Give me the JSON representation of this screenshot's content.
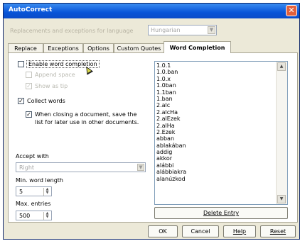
{
  "window": {
    "title": "AutoCorrect"
  },
  "replacements": {
    "label": "Replacements and exceptions for language",
    "language": "Hungarian"
  },
  "tabs": [
    {
      "label": "Replace"
    },
    {
      "label": "Exceptions"
    },
    {
      "label": "Options"
    },
    {
      "label": "Custom Quotes"
    },
    {
      "label": "Word Completion"
    }
  ],
  "word_completion": {
    "enable_label": "Enable word completion",
    "enable_checked": false,
    "append_space_label": "Append space",
    "show_tip_label": "Show as tip",
    "collect_words_label": "Collect words",
    "collect_words_checked": true,
    "when_closing_label_1": "When closing a document, save the",
    "when_closing_label_2": "list for later use in other documents.",
    "when_closing_checked": true,
    "accept_with_label": "Accept with",
    "accept_with_value": "Right",
    "min_length_label": "Min. word length",
    "min_length_value": "5",
    "max_entries_label": "Max. entries",
    "max_entries_value": "500",
    "words": [
      "1.0.1",
      "1.0.ban",
      "1.0.x",
      "1.0ban",
      "1.1ban",
      "1.ban",
      "2.alc",
      "2.alcHa",
      "2.alEzek",
      "2.alHa",
      "2.Ezek",
      "abban",
      "ablakában",
      "addig",
      "akkor",
      "alábbi",
      "alábbiakra",
      "alanúzkod"
    ],
    "delete_entry_label": "Delete Entry"
  },
  "buttons": {
    "ok": "OK",
    "cancel": "Cancel",
    "help": "Help",
    "reset": "Reset"
  },
  "colors": {
    "title_bar": "#0854d8",
    "dialog_bg": "#ece9d8",
    "close_button": "#e2603c"
  }
}
